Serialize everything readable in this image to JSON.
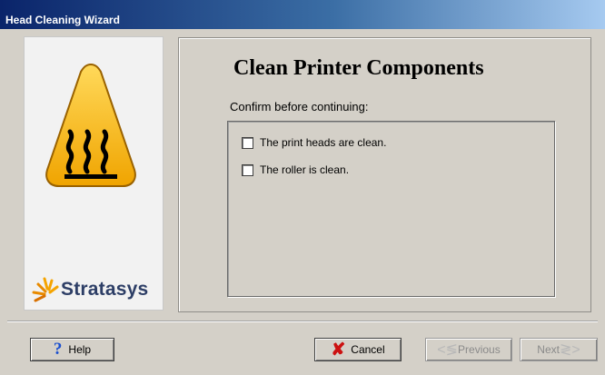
{
  "window": {
    "title": "Head Cleaning Wizard"
  },
  "sidebar": {
    "logo_text": "Stratasys",
    "warning_icon": "hot-surface-warning-icon"
  },
  "main": {
    "heading": "Clean Printer Components",
    "prompt": "Confirm before continuing:",
    "checkboxes": [
      {
        "label": "The print heads are clean.",
        "checked": false
      },
      {
        "label": "The roller is clean.",
        "checked": false
      }
    ]
  },
  "buttons": {
    "help": "Help",
    "cancel": "Cancel",
    "previous": "Previous",
    "next": "Next"
  },
  "colors": {
    "title_bar": "#0a246a",
    "warning_yellow": "#f5b50a",
    "cancel_x": "#cc1111",
    "help_q": "#1a4fcf"
  }
}
